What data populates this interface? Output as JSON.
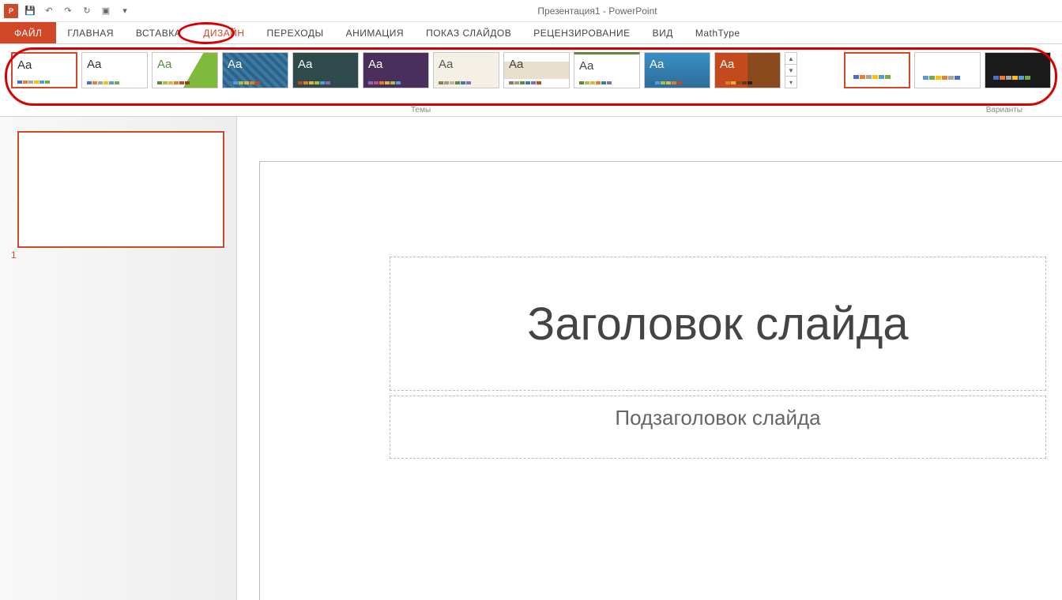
{
  "app": {
    "title": "Презентация1 - PowerPoint",
    "badge": "P"
  },
  "tabs": {
    "file": "ФАЙЛ",
    "home": "ГЛАВНАЯ",
    "insert": "ВСТАВКА",
    "design": "ДИЗАЙН",
    "transitions": "ПЕРЕХОДЫ",
    "animation": "АНИМАЦИЯ",
    "slideshow": "ПОКАЗ СЛАЙДОВ",
    "review": "РЕЦЕНЗИРОВАНИЕ",
    "view": "ВИД",
    "mathtype": "MathType"
  },
  "groups": {
    "themes": "Темы",
    "variants": "Варианты"
  },
  "themes": [
    {
      "aa": "Aa",
      "aa_color": "#333",
      "bg": "tbg1",
      "swatches": [
        "#4472c4",
        "#ed7d31",
        "#a5a5a5",
        "#ffc000",
        "#5b9bd5",
        "#70ad47"
      ],
      "selected": true
    },
    {
      "aa": "Aa",
      "aa_color": "#333",
      "bg": "tbg2",
      "swatches": [
        "#4472c4",
        "#ed7d31",
        "#a5a5a5",
        "#ffc000",
        "#5b9bd5",
        "#70ad47"
      ]
    },
    {
      "aa": "Aa",
      "aa_color": "#5b8a3c",
      "bg": "tbg3",
      "swatches": [
        "#5b8a3c",
        "#a5c249",
        "#e2b33d",
        "#d9822b",
        "#c44a1e",
        "#8a4a1e"
      ]
    },
    {
      "aa": "Aa",
      "aa_color": "#fff",
      "bg": "tbg4",
      "swatches": [
        "#3b7aa3",
        "#5b9bd5",
        "#a5c249",
        "#e2b33d",
        "#d9822b",
        "#c44a1e"
      ]
    },
    {
      "aa": "Aa",
      "aa_color": "#fff",
      "bg": "tbg5",
      "swatches": [
        "#c44a1e",
        "#d9822b",
        "#e2b33d",
        "#a5c249",
        "#5b9bd5",
        "#8a6cb5"
      ]
    },
    {
      "aa": "Aa",
      "aa_color": "#fff",
      "bg": "tbg6",
      "swatches": [
        "#8a6cb5",
        "#c44a8a",
        "#d9822b",
        "#e2b33d",
        "#a5c249",
        "#5b9bd5"
      ]
    },
    {
      "aa": "Aa",
      "aa_color": "#555",
      "bg": "tbg7",
      "swatches": [
        "#8a7a5c",
        "#a59b7c",
        "#c0b89c",
        "#5b8a3c",
        "#3b7aa3",
        "#8a6cb5"
      ]
    },
    {
      "aa": "Aa",
      "aa_color": "#444",
      "bg": "tbg8",
      "swatches": [
        "#8a7a5c",
        "#a59b7c",
        "#5b8a3c",
        "#3b7aa3",
        "#8a6cb5",
        "#c44a1e"
      ]
    },
    {
      "aa": "Aa",
      "aa_color": "#444",
      "bg": "tbg9",
      "swatches": [
        "#5b8a3c",
        "#a5c249",
        "#e2b33d",
        "#d9822b",
        "#3b7aa3",
        "#8a6cb5"
      ]
    },
    {
      "aa": "Aa",
      "aa_color": "#fff",
      "bg": "tbg10",
      "swatches": [
        "#2c6e9b",
        "#5b9bd5",
        "#a5c249",
        "#e2b33d",
        "#d9822b",
        "#c44a1e"
      ]
    },
    {
      "aa": "Aa",
      "aa_color": "#fff",
      "bg": "tbg11",
      "swatches": [
        "#c44a1e",
        "#d9822b",
        "#e2b33d",
        "#8a4a1e",
        "#5b3a1e",
        "#2e1e0e"
      ]
    }
  ],
  "variants": [
    {
      "bg": "vbg1",
      "swatches": [
        "#4472c4",
        "#ed7d31",
        "#a5a5a5",
        "#ffc000",
        "#5b9bd5",
        "#70ad47"
      ],
      "selected": true
    },
    {
      "bg": "vbg2",
      "swatches": [
        "#5b9bd5",
        "#70ad47",
        "#ffc000",
        "#ed7d31",
        "#a5a5a5",
        "#4472c4"
      ]
    },
    {
      "bg": "vbg3",
      "swatches": [
        "#4472c4",
        "#ed7d31",
        "#a5a5a5",
        "#ffc000",
        "#5b9bd5",
        "#70ad47"
      ]
    }
  ],
  "slide": {
    "number": "1",
    "title_placeholder": "Заголовок слайда",
    "subtitle_placeholder": "Подзаголовок слайда"
  }
}
